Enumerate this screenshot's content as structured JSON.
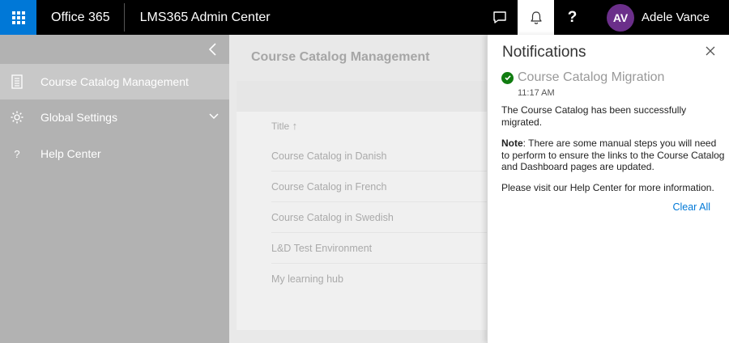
{
  "topbar": {
    "brand": "Office 365",
    "app_title": "LMS365 Admin Center",
    "user_initials": "AV",
    "user_name": "Adele Vance",
    "help_label": "?"
  },
  "sidebar": {
    "items": [
      {
        "label": "Course Catalog Management",
        "icon": "catalog-icon"
      },
      {
        "label": "Global Settings",
        "icon": "gear-icon"
      },
      {
        "label": "Help Center",
        "icon": "help-icon"
      }
    ]
  },
  "main": {
    "page_title": "Course Catalog Management",
    "table": {
      "column_header": "Title",
      "rows": [
        "Course Catalog in Danish",
        "Course Catalog in French",
        "Course Catalog in Swedish",
        "L&D Test Environment",
        "My learning hub"
      ]
    }
  },
  "notifications": {
    "title": "Notifications",
    "item": {
      "title": "Course Catalog Migration",
      "time": "11:17 AM",
      "message": "The Course Catalog has been successfully migrated.",
      "note_label": "Note",
      "note_text": ": There are some manual steps you will need to perform to ensure the links to the Course Catalog and Dashboard pages are updated.",
      "footer": "Please visit our Help Center for more information."
    },
    "clear_all": "Clear All"
  },
  "colors": {
    "accent": "#0078d7",
    "avatar": "#6b2f8a",
    "success": "#107c10"
  }
}
